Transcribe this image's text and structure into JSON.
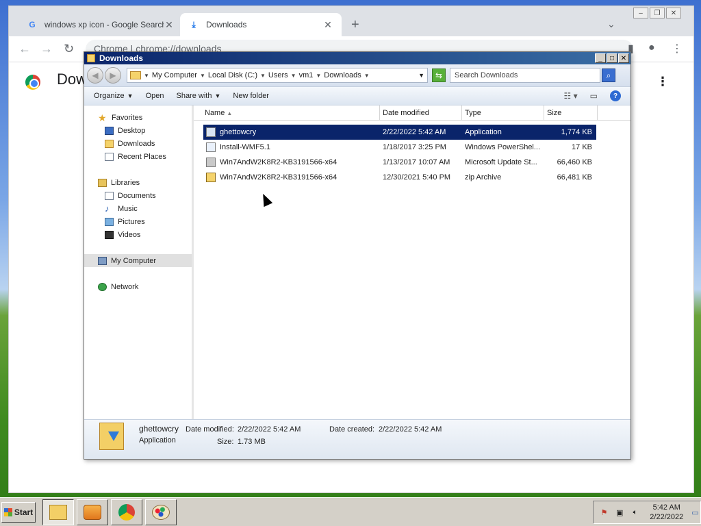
{
  "chrome": {
    "tabs": [
      {
        "title": "windows xp icon - Google Search",
        "favicon": "google-g-icon"
      },
      {
        "title": "Downloads",
        "favicon": "download-icon"
      }
    ],
    "omnibox": "Chrome | chrome://downloads",
    "page_title": "Downloads"
  },
  "explorer": {
    "title": "Downloads",
    "breadcrumbs": [
      "My Computer",
      "Local Disk (C:)",
      "Users",
      "vm1",
      "Downloads"
    ],
    "search_placeholder": "Search Downloads",
    "commands": {
      "organize": "Organize",
      "open": "Open",
      "share": "Share with",
      "new_folder": "New folder"
    },
    "nav": {
      "favorites": "Favorites",
      "favorites_items": [
        "Desktop",
        "Downloads",
        "Recent Places"
      ],
      "libraries": "Libraries",
      "libraries_items": [
        "Documents",
        "Music",
        "Pictures",
        "Videos"
      ],
      "computer": "My Computer",
      "network": "Network"
    },
    "columns": {
      "name": "Name",
      "date": "Date modified",
      "type": "Type",
      "size": "Size"
    },
    "files": [
      {
        "name": "ghettowcry",
        "date": "2/22/2022 5:42 AM",
        "type": "Application",
        "size": "1,774 KB",
        "icon": "application-icon"
      },
      {
        "name": "Install-WMF5.1",
        "date": "1/18/2017 3:25 PM",
        "type": "Windows PowerShel...",
        "size": "17 KB",
        "icon": "powershell-script-icon"
      },
      {
        "name": "Win7AndW2K8R2-KB3191566-x64",
        "date": "1/13/2017 10:07 AM",
        "type": "Microsoft Update St...",
        "size": "66,460 KB",
        "icon": "update-package-icon"
      },
      {
        "name": "Win7AndW2K8R2-KB3191566-x64",
        "date": "12/30/2021 5:40 PM",
        "type": "zip Archive",
        "size": "66,481 KB",
        "icon": "zip-archive-icon"
      }
    ],
    "details": {
      "name": "ghettowcry",
      "type": "Application",
      "modified_label": "Date modified:",
      "modified_value": "2/22/2022 5:42 AM",
      "created_label": "Date created:",
      "created_value": "2/22/2022 5:42 AM",
      "size_label": "Size:",
      "size_value": "1.73 MB"
    }
  },
  "taskbar": {
    "start": "Start",
    "apps": [
      "explorer-icon",
      "media-player-icon",
      "chrome-icon",
      "paint-icon"
    ],
    "time": "5:42 AM",
    "date": "2/22/2022"
  }
}
